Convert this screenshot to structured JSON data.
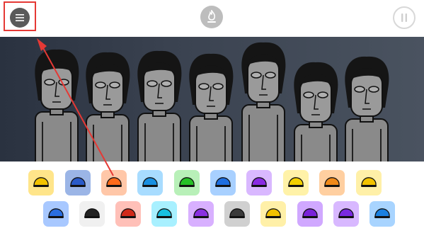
{
  "toolbar": {
    "menu_icon": "menu-icon",
    "center_icon": "fire-badge-icon",
    "pause_icon": "pause-icon",
    "highlight_color": "#e53935"
  },
  "stage": {
    "performer_count": 7,
    "performer_state": "idle"
  },
  "palette": {
    "row1": [
      {
        "name": "yellow-cap-sound-icon",
        "bg": "#ffe58a",
        "fg": "#f2c200"
      },
      {
        "name": "blue-visor-sound-icon",
        "bg": "#9bb5e6",
        "fg": "#2a5bc9"
      },
      {
        "name": "orange-helmet-sound-icon",
        "bg": "#ffc7a8",
        "fg": "#ff6a1a"
      },
      {
        "name": "blue-glasses-sound-icon",
        "bg": "#a8dcff",
        "fg": "#1a8fe0"
      },
      {
        "name": "green-band-sound-icon",
        "bg": "#b8f0b8",
        "fg": "#26c026"
      },
      {
        "name": "blue-cap-sound-icon",
        "bg": "#a8d0ff",
        "fg": "#1e6ee0"
      },
      {
        "name": "purple-triangle-sound-icon",
        "bg": "#d9b8ff",
        "fg": "#8a2be2"
      },
      {
        "name": "yellow-face-sound-icon",
        "bg": "#fff2a8",
        "fg": "#f2d000"
      },
      {
        "name": "orange-splat-sound-icon",
        "bg": "#ffcfa0",
        "fg": "#f08a1a"
      },
      {
        "name": "yellow-beak-sound-icon",
        "bg": "#fff0a8",
        "fg": "#f2c200"
      }
    ],
    "row2": [
      {
        "name": "blue-cap-tilt-sound-icon",
        "bg": "#a8c8ff",
        "fg": "#2a6ee0"
      },
      {
        "name": "white-smile-sound-icon",
        "bg": "#f0f0f0",
        "fg": "#222222"
      },
      {
        "name": "red-monster-sound-icon",
        "bg": "#ffc0b8",
        "fg": "#d02a1a"
      },
      {
        "name": "cyan-hair-sound-icon",
        "bg": "#a8f0ff",
        "fg": "#18c0e0"
      },
      {
        "name": "purple-headphones-sound-icon",
        "bg": "#d8b0ff",
        "fg": "#8a30e0"
      },
      {
        "name": "gray-hat-sound-icon",
        "bg": "#d0d0d0",
        "fg": "#3a3a3a"
      },
      {
        "name": "yellow-cap-2-sound-icon",
        "bg": "#fff0a8",
        "fg": "#f2c200"
      },
      {
        "name": "purple-headphones-2-sound-icon",
        "bg": "#d0a8ff",
        "fg": "#7a22d8"
      },
      {
        "name": "purple-goggles-sound-icon",
        "bg": "#d8b8ff",
        "fg": "#7a2ae0"
      },
      {
        "name": "blue-goggles-sound-icon",
        "bg": "#a8d4ff",
        "fg": "#1a80e0"
      }
    ]
  }
}
